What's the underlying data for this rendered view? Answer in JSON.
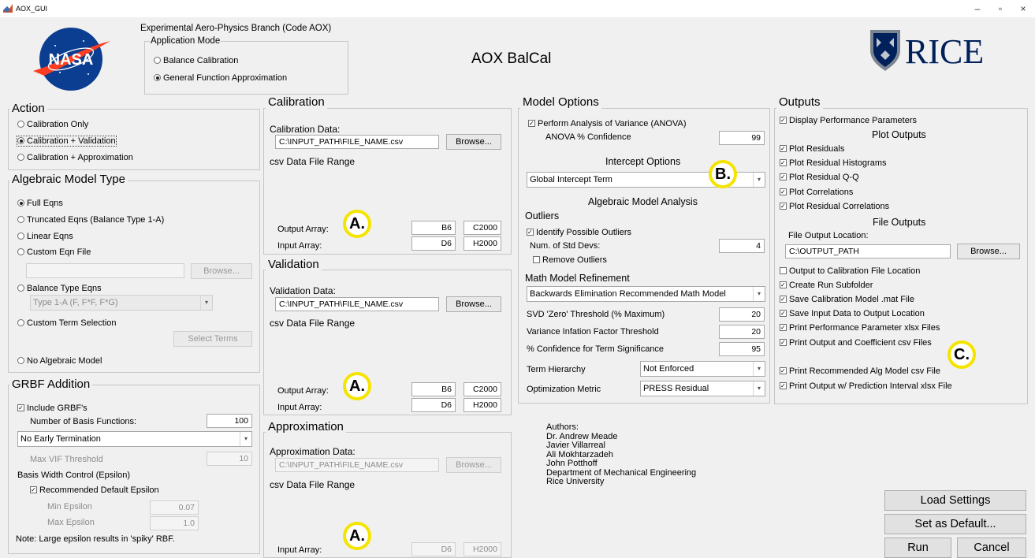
{
  "window": {
    "title": "AOX_GUI",
    "minimize": "–",
    "restore": "▫",
    "close": "×"
  },
  "header": {
    "branch": "Experimental Aero-Physics Branch (Code AOX)",
    "mode_title": "Application Mode",
    "mode_options": [
      "Balance Calibration",
      "General Function Approximation"
    ],
    "app_title": "AOX  BalCal",
    "nasa_logo": "NASA",
    "rice_logo": "RICE"
  },
  "action": {
    "title": "Action",
    "options": [
      "Calibration Only",
      "Calibration + Validation",
      "Calibration + Approximation"
    ]
  },
  "algebraic": {
    "title": "Algebraic Model Type",
    "options": [
      "Full Eqns",
      "Truncated Eqns (Balance Type 1-A)",
      "Linear Eqns",
      "Custom Eqn File"
    ],
    "browse": "Browse...",
    "balance_type": "Balance Type Eqns",
    "balance_select": "Type 1-A (F, F*F, F*G)",
    "custom_term": "Custom Term Selection",
    "select_terms": "Select Terms",
    "no_model": "No Algebraic Model"
  },
  "grbf": {
    "title": "GRBF Addition",
    "include": "Include GRBF's",
    "num_basis_label": "Number of Basis Functions:",
    "num_basis": "100",
    "termination": "No Early Termination",
    "max_vif_label": "Max VIF Threshold",
    "max_vif": "10",
    "width_control": "Basis Width Control (Epsilon)",
    "recommended": "Recommended Default Epsilon",
    "min_eps_label": "Min Epsilon",
    "min_eps": "0.07",
    "max_eps_label": "Max Epsilon",
    "max_eps": "1.0",
    "note": "Note: Large epsilon results in 'spiky' RBF."
  },
  "calibration": {
    "title": "Calibration",
    "data_label": "Calibration Data:",
    "path": "C:\\INPUT_PATH\\FILE_NAME.csv",
    "browse": "Browse...",
    "range": "csv Data File Range",
    "output_label": "Output Array:",
    "out_start": "B6",
    "out_end": "C2000",
    "input_label": "Input Array:",
    "in_start": "D6",
    "in_end": "H2000"
  },
  "validation": {
    "title": "Validation",
    "data_label": "Validation Data:",
    "path": "C:\\INPUT_PATH\\FILE_NAME.csv",
    "browse": "Browse...",
    "range": "csv Data File Range",
    "output_label": "Output Array:",
    "out_start": "B6",
    "out_end": "C2000",
    "input_label": "Input Array:",
    "in_start": "D6",
    "in_end": "H2000"
  },
  "approximation": {
    "title": "Approximation",
    "data_label": "Approximation Data:",
    "path": "C:\\INPUT_PATH\\FILE_NAME.csv",
    "browse": "Browse...",
    "range": "csv Data File Range",
    "input_label": "Input Array:",
    "in_start": "D6",
    "in_end": "H2000"
  },
  "model": {
    "title": "Model Options",
    "anova": "Perform Analysis of Variance (ANOVA)",
    "anova_conf_label": "ANOVA % Confidence",
    "anova_conf": "99",
    "intercept_title": "Intercept Options",
    "intercept": "Global Intercept Term",
    "analysis_title": "Algebraic Model Analysis",
    "outliers_title": "Outliers",
    "identify": "Identify Possible Outliers",
    "std_label": "Num. of Std Devs:",
    "std": "4",
    "remove": "Remove Outliers",
    "refine_title": "Math Model Refinement",
    "refine": "Backwards Elimination Recommended Math Model",
    "svd_label": "SVD 'Zero' Threshold (% Maximum)",
    "svd": "20",
    "vif_label": "Variance Infation Factor Threshold",
    "vif": "20",
    "conf_label": "% Confidence for Term Significance",
    "conf": "95",
    "hier_label": "Term Hierarchy",
    "hier": "Not Enforced",
    "metric_label": "Optimization Metric",
    "metric": "PRESS Residual"
  },
  "authors": [
    "Authors:",
    "Dr. Andrew Meade",
    "Javier Villarreal",
    "Ali Mokhtarzadeh",
    "John Potthoff",
    "Department of Mechanical Engineering",
    "Rice University"
  ],
  "outputs": {
    "title": "Outputs",
    "display": "Display Performance Parameters",
    "plot_title": "Plot Outputs",
    "plots": [
      "Plot Residuals",
      "Plot Residual Histograms",
      "Plot Residual Q-Q",
      "Plot Correlations",
      "Plot Residual Correlations"
    ],
    "file_title": "File Outputs",
    "loc_label": "File Output Location:",
    "loc": "C:\\OUTPUT_PATH",
    "browse": "Browse...",
    "files": [
      "Output to Calibration File Location",
      "Create Run Subfolder",
      "Save Calibration Model .mat File",
      "Save Input Data to Output Location",
      "Print Performance Parameter xlsx Files",
      "Print Output and Coefficient csv Files"
    ],
    "files2": [
      "Print Recommended Alg Model csv File",
      "Print Output w/ Prediction Interval xlsx File"
    ]
  },
  "buttons": {
    "load": "Load Settings",
    "default": "Set as Default...",
    "run": "Run",
    "cancel": "Cancel"
  },
  "annotations": {
    "a": "A.",
    "b": "B.",
    "c": "C."
  },
  "colors": {
    "annotation": "#f5e400",
    "nasa_blue": "#0b3d91",
    "nasa_red": "#fc3d21",
    "rice_blue": "#00205b"
  }
}
